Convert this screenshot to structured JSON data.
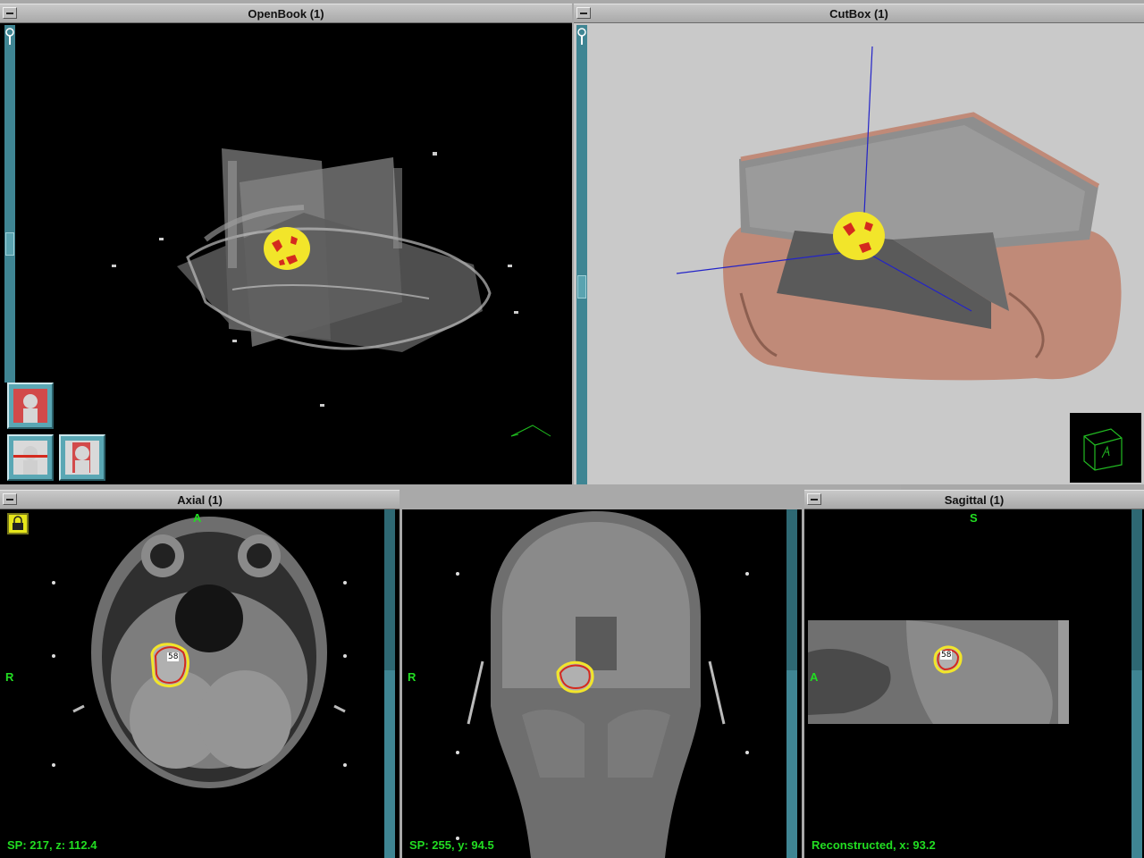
{
  "windows": {
    "openbook": {
      "title": "OpenBook (1)"
    },
    "cutbox": {
      "title": "CutBox (1)"
    },
    "axial": {
      "title": "Axial (1)",
      "orient_top": "A",
      "orient_left": "R",
      "status": "SP: 217, z: 112.4",
      "contour_label": "58"
    },
    "coronal": {
      "orient_left": "R",
      "status": "SP: 255, y: 94.5"
    },
    "sagittal": {
      "title": "Sagittal (1)",
      "orient_top": "S",
      "orient_left": "A",
      "status": "Reconstructed, x: 93.2",
      "contour_label": "58"
    }
  },
  "icons": {
    "zoom": "magnifier-icon",
    "lock": "lock-icon",
    "orient_cube": "orientation-cube-icon",
    "view_coronal": "head-coronal-view-icon",
    "view_axial": "head-axial-view-icon",
    "view_sagittal": "head-sagittal-view-icon"
  },
  "colors": {
    "titlebar": "#b4b4b4",
    "scrollbar": "#3f8593",
    "annotation_green": "#22dd22",
    "tumor_yellow": "#f2e52a",
    "tumor_red": "#d42a1e",
    "cutbox_background": "#c9c9c9",
    "skin": "#c08a78"
  }
}
